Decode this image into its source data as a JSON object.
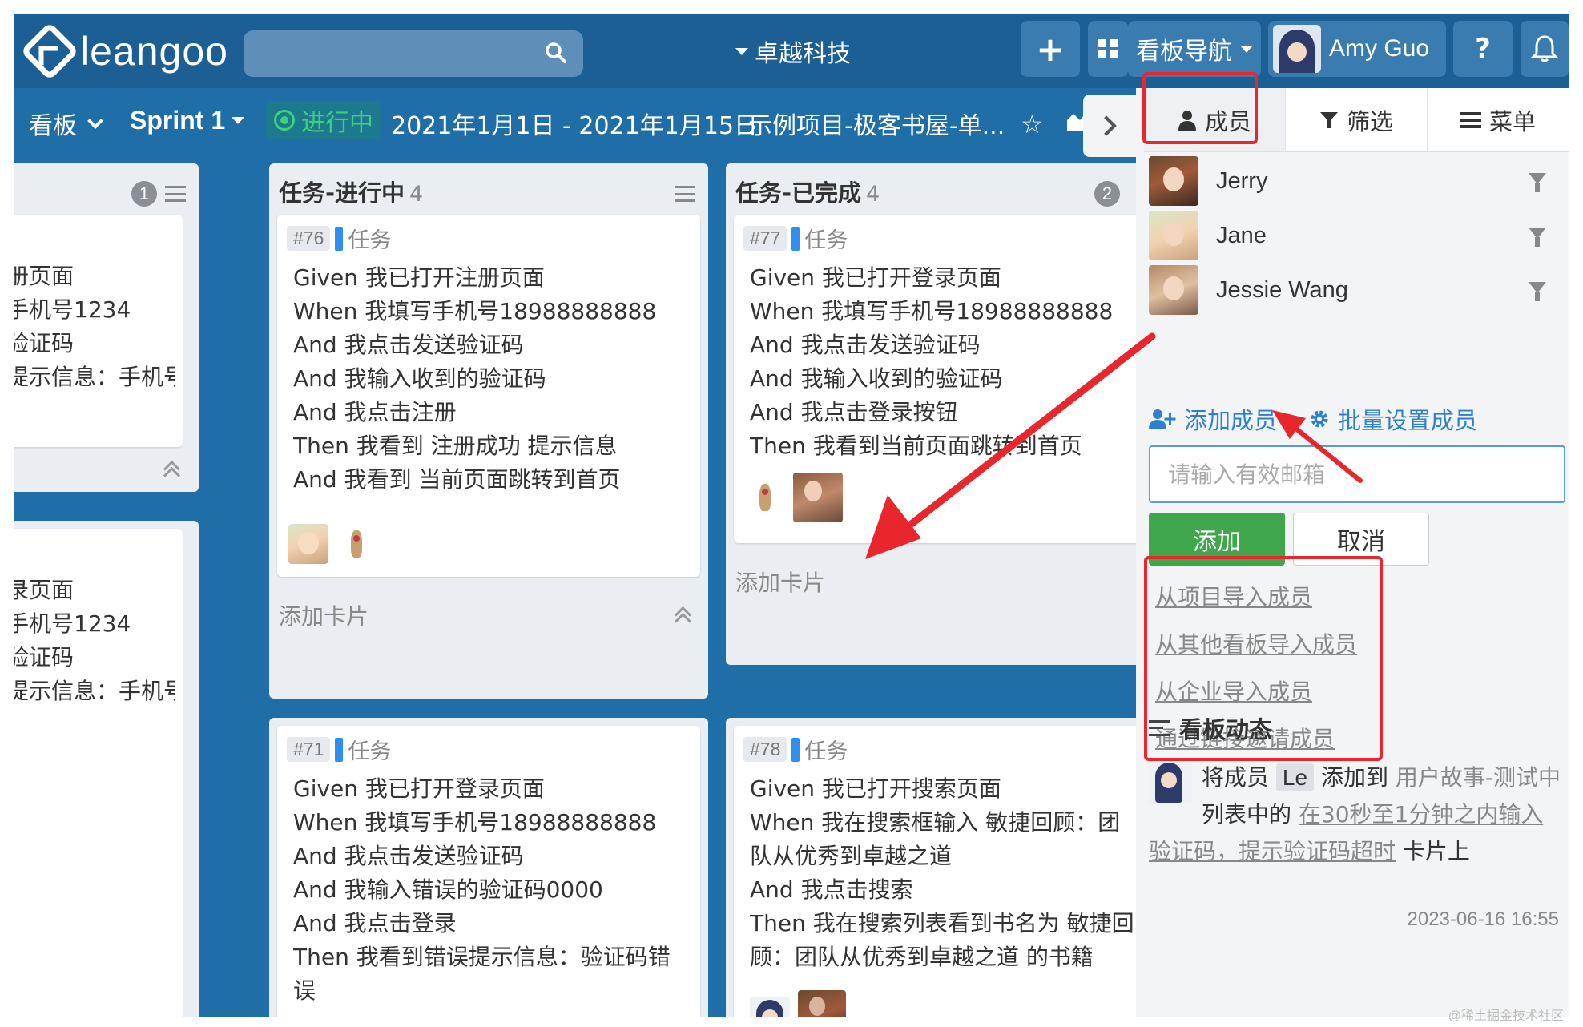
{
  "topbar": {
    "logo_text": "leangoo",
    "search_placeholder": "",
    "org_name": "卓越科技",
    "nav_label": "看板导航",
    "user_name": "Amy Guo",
    "help_label": "?"
  },
  "subbar": {
    "board_label": "看板",
    "sprint_label": "Sprint 1",
    "status_label": "进行中",
    "date_range": "2021年1月1日 - 2021年1月15日",
    "project_name": "示例项目-极客书屋-单..."
  },
  "lists": [
    {
      "title": "",
      "badge": "1",
      "cards": [
        {
          "lines": [
            "册页面",
            "手机号1234",
            "验证码",
            "提示信息：手机号格"
          ]
        },
        {
          "lines": [
            "录页面",
            "手机号1234",
            "验证码",
            "提示信息：手机号格"
          ]
        }
      ]
    },
    {
      "title": "任务-进行中",
      "count": "4",
      "add_card": "添加卡片",
      "cards": [
        {
          "id": "#76",
          "type": "任务",
          "lines": [
            "Given 我已打开注册页面",
            "When 我填写手机号18988888888",
            "And 我点击发送验证码",
            "And 我输入收到的验证码",
            "And 我点击注册",
            "Then 我看到 注册成功 提示信息",
            "And 我看到 当前页面跳转到首页"
          ]
        },
        {
          "id": "#71",
          "type": "任务",
          "lines": [
            "Given 我已打开登录页面",
            "When 我填写手机号18988888888",
            "And 我点击发送验证码",
            "And 我输入错误的验证码0000",
            "And 我点击登录",
            "Then 我看到错误提示信息：验证码错误"
          ]
        }
      ]
    },
    {
      "title": "任务-已完成",
      "count": "4",
      "badge": "2",
      "add_card": "添加卡片",
      "cards": [
        {
          "id": "#77",
          "type": "任务",
          "lines": [
            "Given 我已打开登录页面",
            "When 我填写手机号18988888888",
            "And 我点击发送验证码",
            "And 我输入收到的验证码",
            "And 我点击登录按钮",
            "Then 我看到当前页面跳转到首页"
          ]
        },
        {
          "id": "#78",
          "type": "任务",
          "lines": [
            "Given 我已打开搜索页面",
            "When 我在搜索框输入 敏捷回顾：团",
            "队从优秀到卓越之道",
            "And 我点击搜索",
            "Then 我在搜索列表看到书名为 敏捷回",
            "顾：团队从优秀到卓越之道 的书籍"
          ]
        }
      ]
    }
  ],
  "panel": {
    "tabs": [
      {
        "label": "成员",
        "icon": "user-icon"
      },
      {
        "label": "筛选",
        "icon": "filter-icon"
      },
      {
        "label": "菜单",
        "icon": "menu-icon"
      }
    ],
    "members": [
      {
        "name": "Jerry"
      },
      {
        "name": "Jane"
      },
      {
        "name": "Jessie Wang"
      }
    ],
    "add_member": "添加成员",
    "batch_set": "批量设置成员",
    "email_placeholder": "请输入有效邮箱",
    "add_button": "添加",
    "cancel_button": "取消",
    "import_links": [
      "从项目导入成员",
      "从其他看板导入成员",
      "从企业导入成员",
      "通过链接邀请成员"
    ],
    "activity_title": "看板动态",
    "activity": {
      "part1": "将成员",
      "member_badge": "Le",
      "part2": "添加到",
      "list_name": "用户故事-测试中",
      "part3": "列表中的",
      "card_link": "在30秒至1分钟之内输入验证码，提示验证码超时",
      "part4": "卡片上",
      "time": "2023-06-16 16:55"
    }
  },
  "watermark": "@稀土掘金技术社区",
  "colors": {
    "board_bg": "#1f6ea8",
    "topbar_bg": "#1b5f95",
    "highlight": "#e8262b",
    "add_button": "#3fa64b",
    "link_blue": "#2f7fd1",
    "status_green": "#3ed07a"
  }
}
